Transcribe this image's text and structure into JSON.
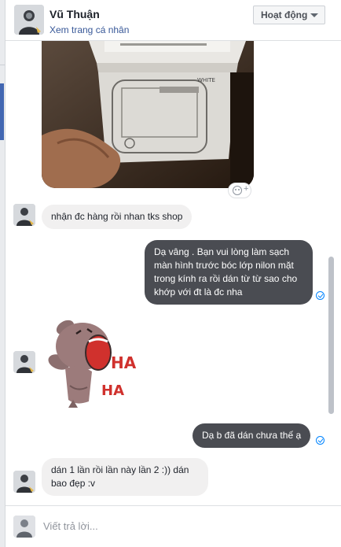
{
  "header": {
    "name": "Vũ Thuận",
    "profile_link": "Xem trang cá nhân",
    "status_button": "Hoạt động"
  },
  "messages": [
    {
      "from": "contact",
      "type": "photo",
      "image_caption_text": "WHITE"
    },
    {
      "from": "contact",
      "type": "text",
      "text": "nhận đc hàng rồi nhan tks shop"
    },
    {
      "from": "me",
      "type": "text",
      "text": "Dạ vâng . Bạn vui lòng làm sạch màn hình trước bóc lớp nilon mặt trong kính ra rồi dán từ từ sao cho khớp với đt là đc nha"
    },
    {
      "from": "contact",
      "type": "sticker",
      "sticker_text": [
        "HA",
        "HA"
      ]
    },
    {
      "from": "me",
      "type": "text",
      "text": "Dạ b đã dán chưa thế ạ"
    },
    {
      "from": "contact",
      "type": "text",
      "text": "dán 1 lần rồi lần này lần 2 :)) dán bao đẹp :v"
    }
  ],
  "composer": {
    "placeholder": "Viết trả lời..."
  },
  "colors": {
    "outgoing_bubble": "#4a4c52",
    "incoming_bubble": "#f1f0f0",
    "link": "#385898",
    "seen_icon": "#0084ff"
  },
  "icons": {
    "status_caret": "chevron-down-icon",
    "reaction": "add-reaction-icon",
    "seen": "seen-check-icon"
  }
}
